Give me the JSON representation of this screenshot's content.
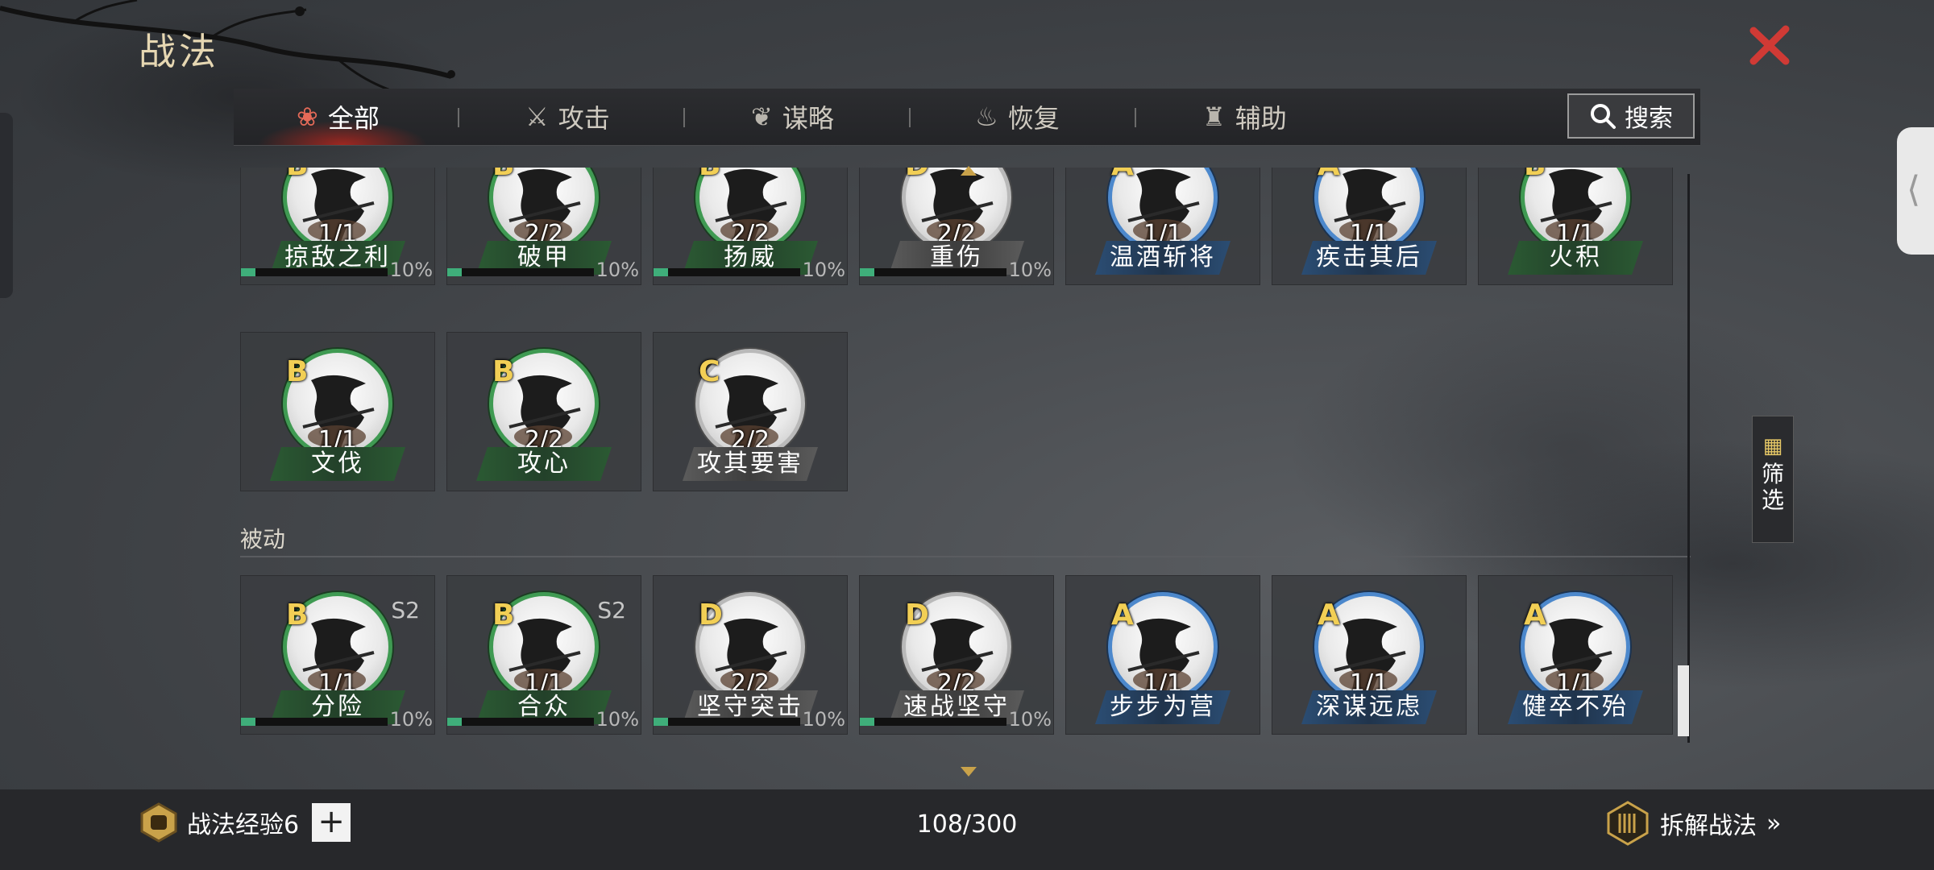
{
  "title": "战法",
  "tabs": [
    {
      "label": "全部",
      "icon": "scroll-bundle-icon",
      "active": true
    },
    {
      "label": "攻击",
      "icon": "crossed-swords-icon",
      "active": false
    },
    {
      "label": "谋略",
      "icon": "feather-fan-icon",
      "active": false
    },
    {
      "label": "恢复",
      "icon": "healing-pot-icon",
      "active": false
    },
    {
      "label": "辅助",
      "icon": "pouch-icon",
      "active": false
    }
  ],
  "search_label": "搜索",
  "filter_label": "筛选",
  "rows": [
    {
      "cards": [
        {
          "grade": "B",
          "level": "1/1",
          "name": "掠敌之利",
          "progress": "10%",
          "season": ""
        },
        {
          "grade": "B",
          "level": "2/2",
          "name": "破甲",
          "progress": "10%",
          "season": ""
        },
        {
          "grade": "B",
          "level": "2/2",
          "name": "扬威",
          "progress": "10%",
          "season": ""
        },
        {
          "grade": "D",
          "level": "2/2",
          "name": "重伤",
          "progress": "10%",
          "season": ""
        },
        {
          "grade": "A",
          "level": "1/1",
          "name": "温酒斩将",
          "progress": "",
          "season": ""
        },
        {
          "grade": "A",
          "level": "1/1",
          "name": "疾击其后",
          "progress": "",
          "season": ""
        },
        {
          "grade": "B",
          "level": "1/1",
          "name": "火积",
          "progress": "",
          "season": ""
        }
      ]
    },
    {
      "cards": [
        {
          "grade": "B",
          "level": "1/1",
          "name": "文伐",
          "progress": "",
          "season": ""
        },
        {
          "grade": "B",
          "level": "2/2",
          "name": "攻心",
          "progress": "",
          "season": ""
        },
        {
          "grade": "C",
          "level": "2/2",
          "name": "攻其要害",
          "progress": "",
          "season": ""
        }
      ]
    },
    {
      "section": "被动",
      "cards": [
        {
          "grade": "B",
          "level": "1/1",
          "name": "分险",
          "progress": "10%",
          "season": "S2"
        },
        {
          "grade": "B",
          "level": "1/1",
          "name": "合众",
          "progress": "10%",
          "season": "S2"
        },
        {
          "grade": "D",
          "level": "2/2",
          "name": "坚守突击",
          "progress": "10%",
          "season": ""
        },
        {
          "grade": "D",
          "level": "2/2",
          "name": "速战坚守",
          "progress": "10%",
          "season": ""
        },
        {
          "grade": "A",
          "level": "1/1",
          "name": "步步为营",
          "progress": "",
          "season": ""
        },
        {
          "grade": "A",
          "level": "1/1",
          "name": "深谋远虑",
          "progress": "",
          "season": ""
        },
        {
          "grade": "A",
          "level": "1/1",
          "name": "健卒不殆",
          "progress": "",
          "season": ""
        }
      ]
    }
  ],
  "bottom": {
    "exp_label": "战法经验6",
    "plus_label": "+",
    "count": "108/300",
    "dismantle_label": "拆解战法",
    "dismantle_arrow": "»"
  },
  "colors": {
    "grade_text": "#f2cf55",
    "grade_B": "#3f9a52",
    "grade_A": "#4c88cc",
    "grade_C": "#b9b9b9",
    "grade_D": "#b9b9b9",
    "close": "#d03a35",
    "progress_fill": "#3fae7a"
  }
}
